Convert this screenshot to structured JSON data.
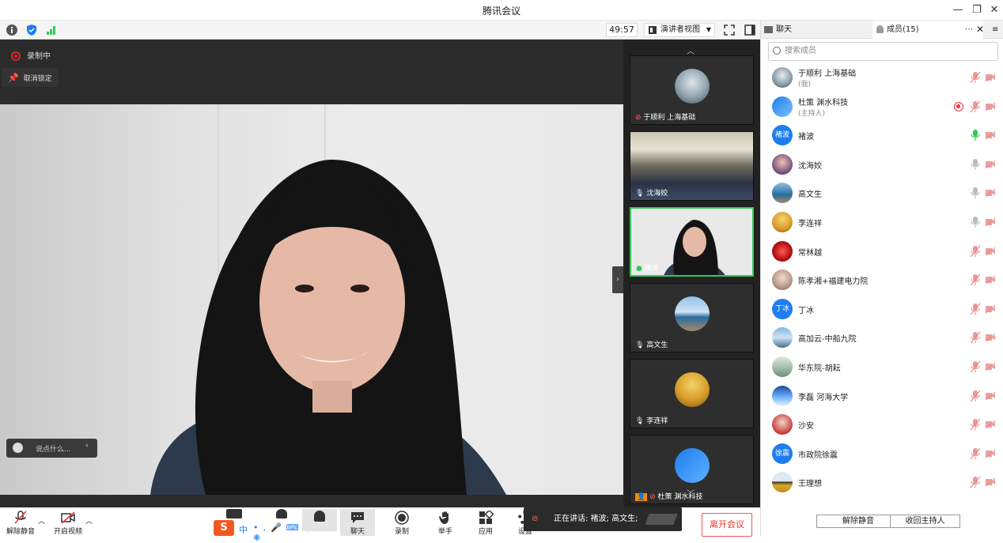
{
  "window": {
    "title": "腾讯会议"
  },
  "toolbar": {
    "timer": "49:57",
    "view_mode": "演讲者视图"
  },
  "stage": {
    "recording_label": "录制中",
    "unpin_label": "取消锁定",
    "chat_placeholder": "说点什么..."
  },
  "thumbnails": [
    {
      "name": "于顺利 上海基础"
    },
    {
      "name": "沈海姣"
    },
    {
      "name": "褚波"
    },
    {
      "name": "高文生"
    },
    {
      "name": "李连祥"
    },
    {
      "name": "杜策 渊水科技"
    }
  ],
  "bottom_bar": {
    "mute": "解除静音",
    "video": "开启视频",
    "chat": "聊天",
    "record": "录制",
    "raise_hand": "举手",
    "apps": "应用",
    "settings": "设置",
    "ime_label": "中",
    "speaking": "正在讲话: 褚波; 高文生;",
    "leave": "离开会议"
  },
  "panel": {
    "tab_chat": "聊天",
    "tab_members": "成员(15)",
    "search_placeholder": "搜索成员",
    "members": [
      {
        "name": "于顺利 上海基础",
        "role": "(我)",
        "mic": "muted"
      },
      {
        "name": "杜策 渊水科技",
        "role": "(主持人)",
        "mic": "muted",
        "recording": true
      },
      {
        "name": "褚波",
        "avatar_text": "褚波",
        "mic": "speaking"
      },
      {
        "name": "沈海姣",
        "mic": "on"
      },
      {
        "name": "高文生",
        "mic": "on"
      },
      {
        "name": "李连祥",
        "mic": "on"
      },
      {
        "name": "常林越",
        "mic": "muted"
      },
      {
        "name": "陈孝湘+福建电力院",
        "mic": "muted"
      },
      {
        "name": "丁冰",
        "avatar_text": "丁冰",
        "mic": "muted"
      },
      {
        "name": "高加云-中船九院",
        "mic": "muted"
      },
      {
        "name": "华东院-胡耘",
        "mic": "muted"
      },
      {
        "name": "李磊 河海大学",
        "mic": "muted"
      },
      {
        "name": "沙安",
        "mic": "muted"
      },
      {
        "name": "市政院徐震",
        "avatar_text": "徐震",
        "mic": "muted"
      },
      {
        "name": "王理想",
        "mic": "muted"
      }
    ],
    "unmute_all": "解除静音",
    "reclaim_host": "收回主持人"
  },
  "colors": {
    "accent_green": "#34c759",
    "accent_red": "#e33333",
    "avatar_blue": "#1e7df0"
  }
}
